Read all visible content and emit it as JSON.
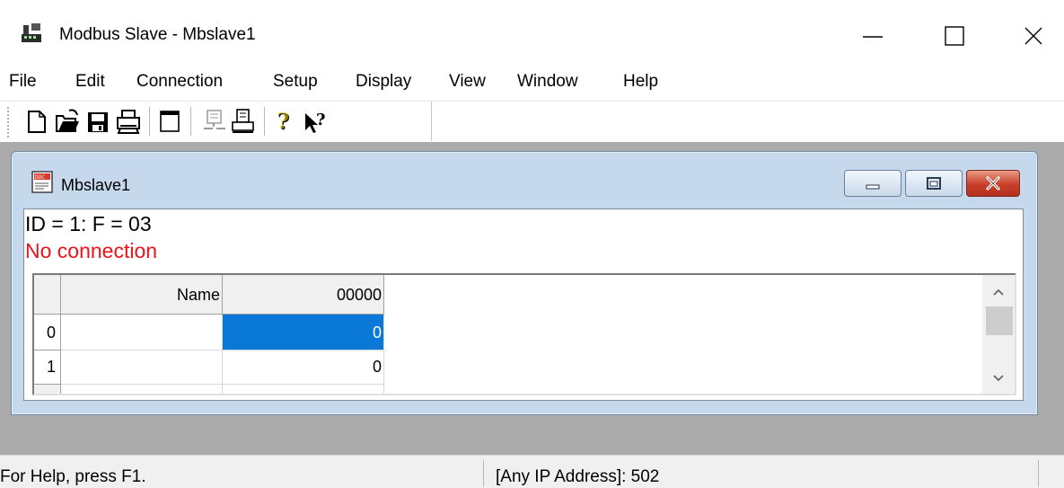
{
  "window": {
    "title": "Modbus Slave - Mbslave1",
    "icon": "modbus-app-icon",
    "controls": [
      "minimize-icon",
      "maximize-icon",
      "close-icon"
    ]
  },
  "menu": [
    "File",
    "Edit",
    "Connection",
    "Setup",
    "Display",
    "View",
    "Window",
    "Help"
  ],
  "toolbar": {
    "icons": [
      "new-file-icon",
      "open-folder-icon",
      "save-icon",
      "print-icon",
      "window-icon",
      "disconnect-icon",
      "connect-icon",
      "help-icon",
      "context-help-icon"
    ]
  },
  "child_window": {
    "title": "Mbslave1",
    "icon": "doc-icon",
    "id_line": "ID = 1: F = 03",
    "status_line": "No connection",
    "status_color": "#e8131b",
    "grid": {
      "headers": [
        "Name",
        "00000"
      ],
      "rows": [
        {
          "index": "0",
          "name": "",
          "value": "0",
          "selected": true
        },
        {
          "index": "1",
          "name": "",
          "value": "0",
          "selected": false
        }
      ],
      "selection_color": "#0a78d7"
    }
  },
  "statusbar": {
    "help": "For Help, press F1.",
    "address": "[Any IP Address]: 502"
  }
}
